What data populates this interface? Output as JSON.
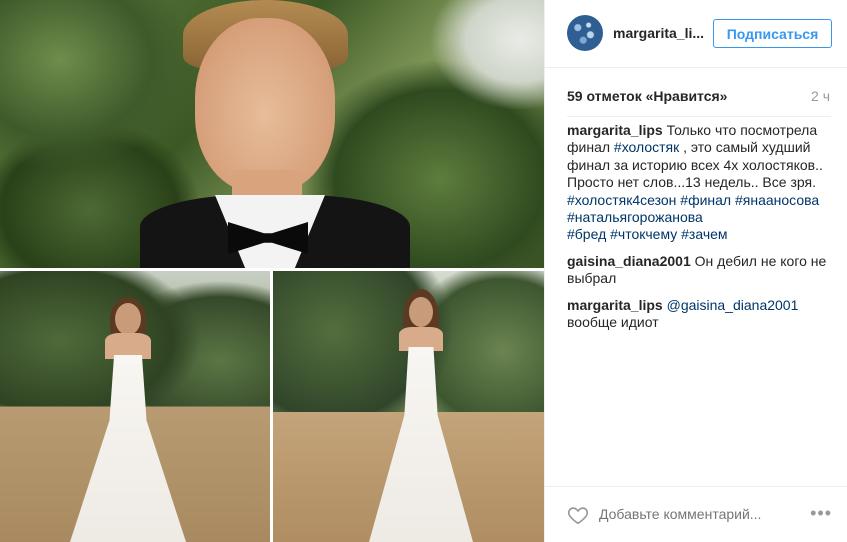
{
  "post": {
    "username": "margarita_li...",
    "follow_label": "Подписаться",
    "likes": "59 отметок «Нравится»",
    "time": "2 ч"
  },
  "comments": [
    {
      "user": "margarita_lips",
      "lines": [
        [
          {
            "t": "Только что посмотрела",
            "tag": false
          }
        ],
        [
          {
            "t": "финал ",
            "tag": false
          },
          {
            "t": "#холостяк",
            "tag": true
          },
          {
            "t": " , это самый худший",
            "tag": false
          }
        ],
        [
          {
            "t": "финал за историю всех 4х холостяков..",
            "tag": false
          }
        ],
        [
          {
            "t": "Просто нет слов...13 недель.. Все зря.",
            "tag": false
          }
        ],
        [
          {
            "t": "#холостяк4сезон",
            "tag": true
          },
          {
            "t": " ",
            "tag": false
          },
          {
            "t": "#финал",
            "tag": true
          },
          {
            "t": " ",
            "tag": false
          },
          {
            "t": "#янааносова",
            "tag": true
          }
        ],
        [
          {
            "t": "#натальягорожанова",
            "tag": true
          }
        ],
        [
          {
            "t": "#бред",
            "tag": true
          },
          {
            "t": " ",
            "tag": false
          },
          {
            "t": "#чтокчему",
            "tag": true
          },
          {
            "t": " ",
            "tag": false
          },
          {
            "t": "#зачем",
            "tag": true
          }
        ]
      ]
    },
    {
      "user": "gaisina_diana2001",
      "lines": [
        [
          {
            "t": "Он дебил не кого не",
            "tag": false
          }
        ],
        [
          {
            "t": "выбрал",
            "tag": false
          }
        ]
      ]
    },
    {
      "user": "margarita_lips",
      "lines": [
        [
          {
            "t": "@gaisina_diana2001",
            "tag": true
          }
        ],
        [
          {
            "t": "вообще идиот",
            "tag": false
          }
        ]
      ]
    }
  ],
  "add_comment": {
    "placeholder": "Добавьте комментарий...",
    "more_label": "•••"
  },
  "icons": {
    "like": "heart-icon",
    "more": "more-options-icon",
    "avatar": "profile-avatar"
  },
  "colors": {
    "accent": "#3897f0",
    "hashtag": "#003569",
    "muted": "#999999",
    "text": "#262626"
  }
}
